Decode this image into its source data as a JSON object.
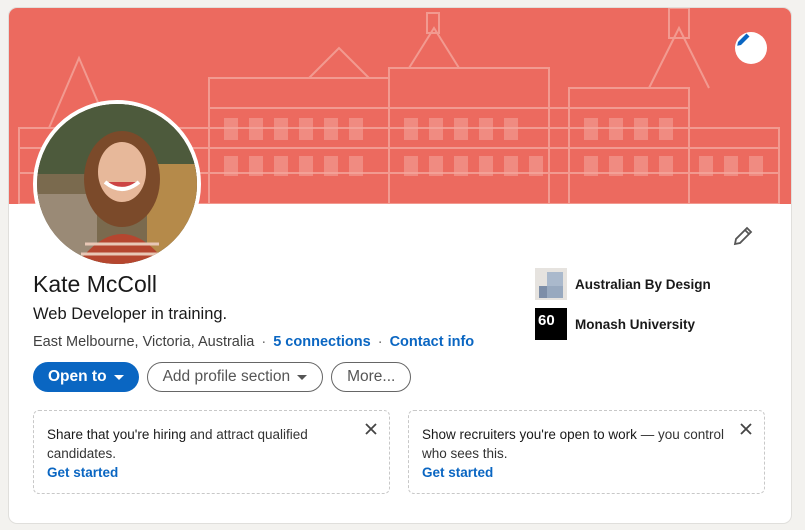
{
  "profile": {
    "name": "Kate McColl",
    "headline": "Web Developer in training.",
    "location": "East Melbourne, Victoria, Australia",
    "connections": "5 connections",
    "contact": "Contact info"
  },
  "experience": [
    {
      "label": "Australian By Design",
      "logo": "abd-logo"
    },
    {
      "label": "Monash University",
      "logo": "monash-logo",
      "logo_text": "60"
    }
  ],
  "actions": {
    "open_to": "Open to",
    "add_section": "Add profile section",
    "more": "More..."
  },
  "promos": [
    {
      "strong": "Share that you're hiring",
      "rest": " and attract qualified candidates.",
      "link": "Get started"
    },
    {
      "strong": "Show recruiters you're open to work",
      "rest": " — you control who sees this.",
      "link": "Get started"
    }
  ],
  "colors": {
    "banner": "#ec6a5f",
    "accent": "#0a66c2"
  },
  "icons": {
    "banner_edit": "pencil-icon",
    "intro_edit": "pencil-icon",
    "close": "close-icon",
    "dropdown": "caret-down-icon"
  }
}
